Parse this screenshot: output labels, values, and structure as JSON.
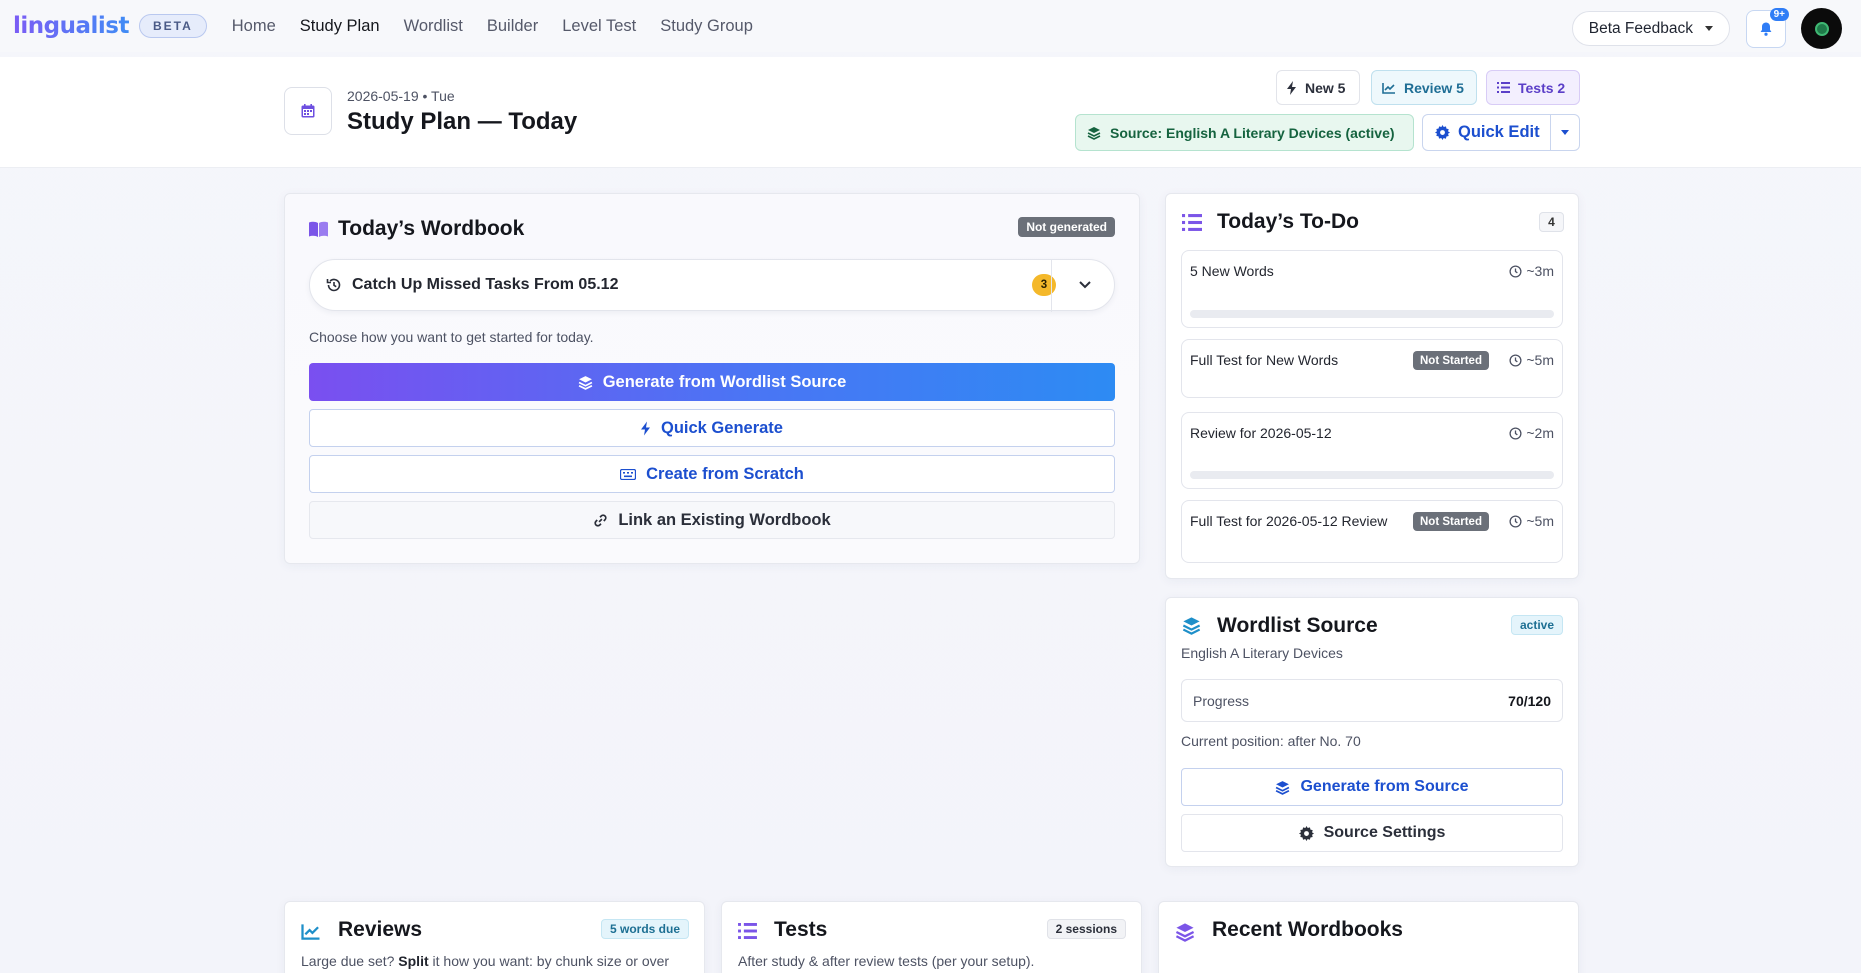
{
  "nav": {
    "logo": "lingualist",
    "beta": "BETA",
    "links": [
      "Home",
      "Study Plan",
      "Wordlist",
      "Builder",
      "Level Test",
      "Study Group"
    ],
    "active_link": "Study Plan",
    "feedback_label": "Beta Feedback",
    "notification_badge": "9+"
  },
  "header": {
    "date": "2026-05-19 • Tue",
    "title": "Study Plan — Today",
    "chips": {
      "new": "New 5",
      "review": "Review 5",
      "tests": "Tests 2"
    },
    "source_badge": "Source: English A Literary Devices (active)",
    "quick_edit": "Quick Edit"
  },
  "wordbook": {
    "title": "Today’s Wordbook",
    "status": "Not generated",
    "catchup_label": "Catch Up Missed Tasks From 05.12",
    "catchup_count": "3",
    "helper": "Choose how you want to get started for today.",
    "buttons": {
      "generate": "Generate from Wordlist Source",
      "quick": "Quick Generate",
      "scratch": "Create from Scratch",
      "link": "Link an Existing Wordbook"
    }
  },
  "todo": {
    "title": "Today’s To-Do",
    "count": "4",
    "items": [
      {
        "label": "5 New Words",
        "time": "~3m",
        "status": "",
        "progress": 0
      },
      {
        "label": "Full Test for New Words",
        "time": "~5m",
        "status": "Not Started"
      },
      {
        "label": "Review for 2026-05-12",
        "time": "~2m",
        "status": "",
        "progress": 0
      },
      {
        "label": "Full Test for 2026-05-12 Review",
        "time": "~5m",
        "status": "Not Started"
      }
    ]
  },
  "source": {
    "title": "Wordlist Source",
    "status": "active",
    "name": "English A Literary Devices",
    "progress_label": "Progress",
    "progress_value": "70/120",
    "current_position": "Current position: after No. 70",
    "generate_label": "Generate from Source",
    "settings_label": "Source Settings"
  },
  "reviews": {
    "title": "Reviews",
    "badge": "5 words due",
    "subtitle_prefix": "Large due set? ",
    "subtitle_bold": "Split",
    "subtitle_suffix": " it how you want: by chunk size or over"
  },
  "tests": {
    "title": "Tests",
    "badge": "2 sessions",
    "subtitle": "After study & after review tests (per your setup)."
  },
  "recent": {
    "title": "Recent Wordbooks"
  },
  "colors": {
    "accent_blue": "#1c4fcf",
    "primary_gradient_start": "#7a4ff0",
    "primary_gradient_end": "#2d8bf3",
    "active_green": "#15633f",
    "warning_yellow": "#f4b82a"
  }
}
